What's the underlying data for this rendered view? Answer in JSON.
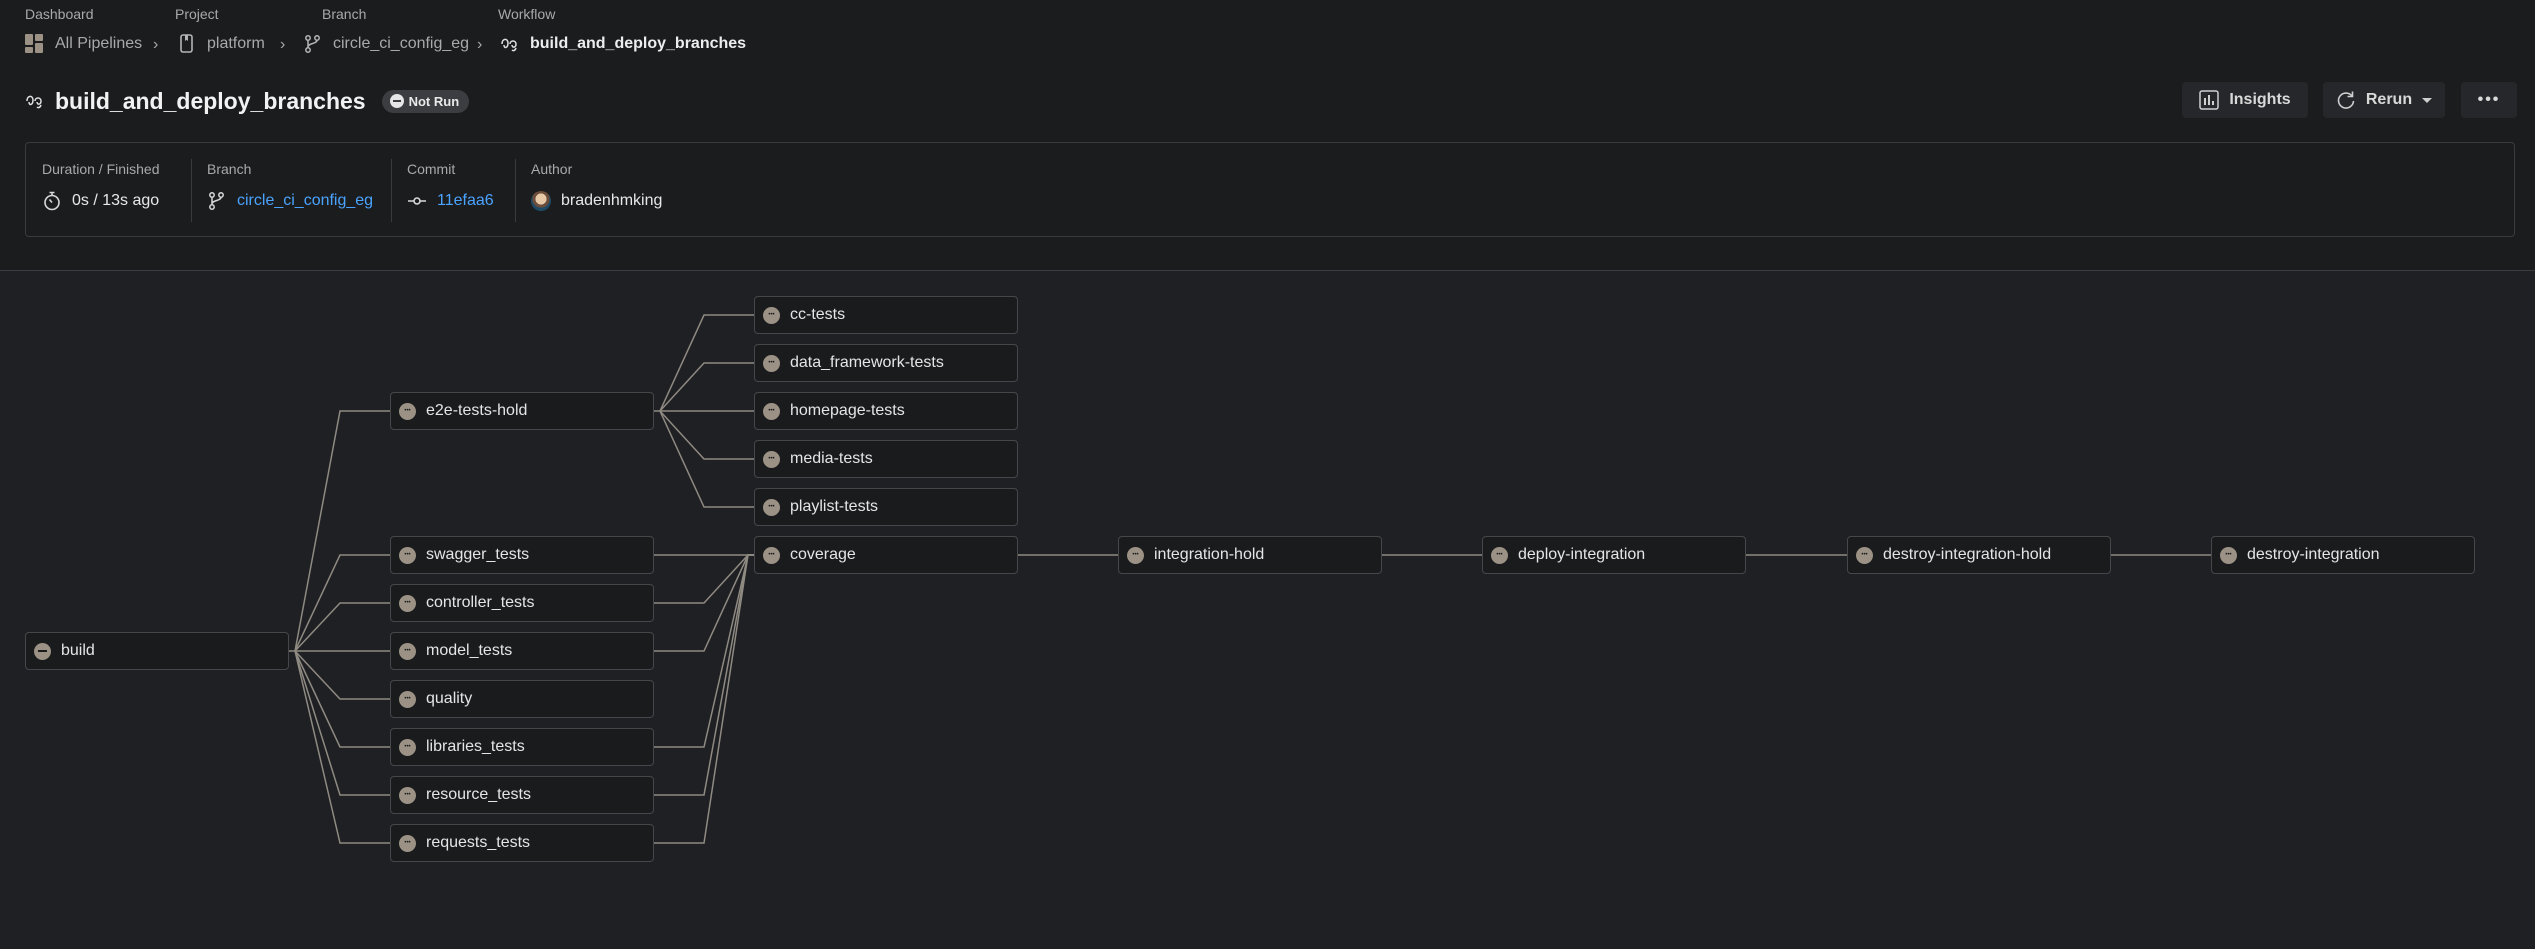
{
  "breadcrumb": {
    "labels": [
      "Dashboard",
      "Project",
      "Branch",
      "Workflow"
    ],
    "items": [
      {
        "label": "All Pipelines",
        "icon": "dashboard-grid-icon"
      },
      {
        "label": "platform",
        "icon": "project-bookmark-icon"
      },
      {
        "label": "circle_ci_config_eg",
        "icon": "branch-icon"
      },
      {
        "label": "build_and_deploy_branches",
        "icon": "workflow-icon"
      }
    ]
  },
  "header": {
    "title": "build_and_deploy_branches",
    "status": "Not Run",
    "insights_label": "Insights",
    "rerun_label": "Rerun",
    "more_label": "•••"
  },
  "info": {
    "duration_label": "Duration / Finished",
    "duration_value": "0s / 13s ago",
    "branch_label": "Branch",
    "branch_value": "circle_ci_config_eg",
    "commit_label": "Commit",
    "commit_value": "11efaa6",
    "author_label": "Author",
    "author_value": "bradenhmking"
  },
  "colors": {
    "link": "#4aa3ff",
    "status_icon": "#9b9184",
    "edge": "#8f8a82"
  },
  "jobs": [
    {
      "id": "build",
      "name": "build",
      "status": "not-run"
    },
    {
      "id": "e2e",
      "name": "e2e-tests-hold",
      "status": "blocked"
    },
    {
      "id": "swagger",
      "name": "swagger_tests",
      "status": "blocked"
    },
    {
      "id": "controller",
      "name": "controller_tests",
      "status": "blocked"
    },
    {
      "id": "model",
      "name": "model_tests",
      "status": "blocked"
    },
    {
      "id": "quality",
      "name": "quality",
      "status": "blocked"
    },
    {
      "id": "libraries",
      "name": "libraries_tests",
      "status": "blocked"
    },
    {
      "id": "resource",
      "name": "resource_tests",
      "status": "blocked"
    },
    {
      "id": "requests",
      "name": "requests_tests",
      "status": "blocked"
    },
    {
      "id": "cc",
      "name": "cc-tests",
      "status": "blocked"
    },
    {
      "id": "dataframework",
      "name": "data_framework-tests",
      "status": "blocked"
    },
    {
      "id": "homepage",
      "name": "homepage-tests",
      "status": "blocked"
    },
    {
      "id": "media",
      "name": "media-tests",
      "status": "blocked"
    },
    {
      "id": "playlist",
      "name": "playlist-tests",
      "status": "blocked"
    },
    {
      "id": "coverage",
      "name": "coverage",
      "status": "blocked"
    },
    {
      "id": "inthold",
      "name": "integration-hold",
      "status": "blocked"
    },
    {
      "id": "deployint",
      "name": "deploy-integration",
      "status": "blocked"
    },
    {
      "id": "destroyhold",
      "name": "destroy-integration-hold",
      "status": "blocked"
    },
    {
      "id": "destroyint",
      "name": "destroy-integration",
      "status": "blocked"
    }
  ],
  "edges": [
    [
      "build",
      "e2e"
    ],
    [
      "build",
      "swagger"
    ],
    [
      "build",
      "controller"
    ],
    [
      "build",
      "model"
    ],
    [
      "build",
      "quality"
    ],
    [
      "build",
      "libraries"
    ],
    [
      "build",
      "resource"
    ],
    [
      "build",
      "requests"
    ],
    [
      "e2e",
      "cc"
    ],
    [
      "e2e",
      "dataframework"
    ],
    [
      "e2e",
      "homepage"
    ],
    [
      "e2e",
      "media"
    ],
    [
      "e2e",
      "playlist"
    ],
    [
      "swagger",
      "coverage"
    ],
    [
      "controller",
      "coverage"
    ],
    [
      "model",
      "coverage"
    ],
    [
      "libraries",
      "coverage"
    ],
    [
      "resource",
      "coverage"
    ],
    [
      "requests",
      "coverage"
    ],
    [
      "coverage",
      "inthold"
    ],
    [
      "inthold",
      "deployint"
    ],
    [
      "deployint",
      "destroyhold"
    ],
    [
      "destroyhold",
      "destroyint"
    ]
  ]
}
